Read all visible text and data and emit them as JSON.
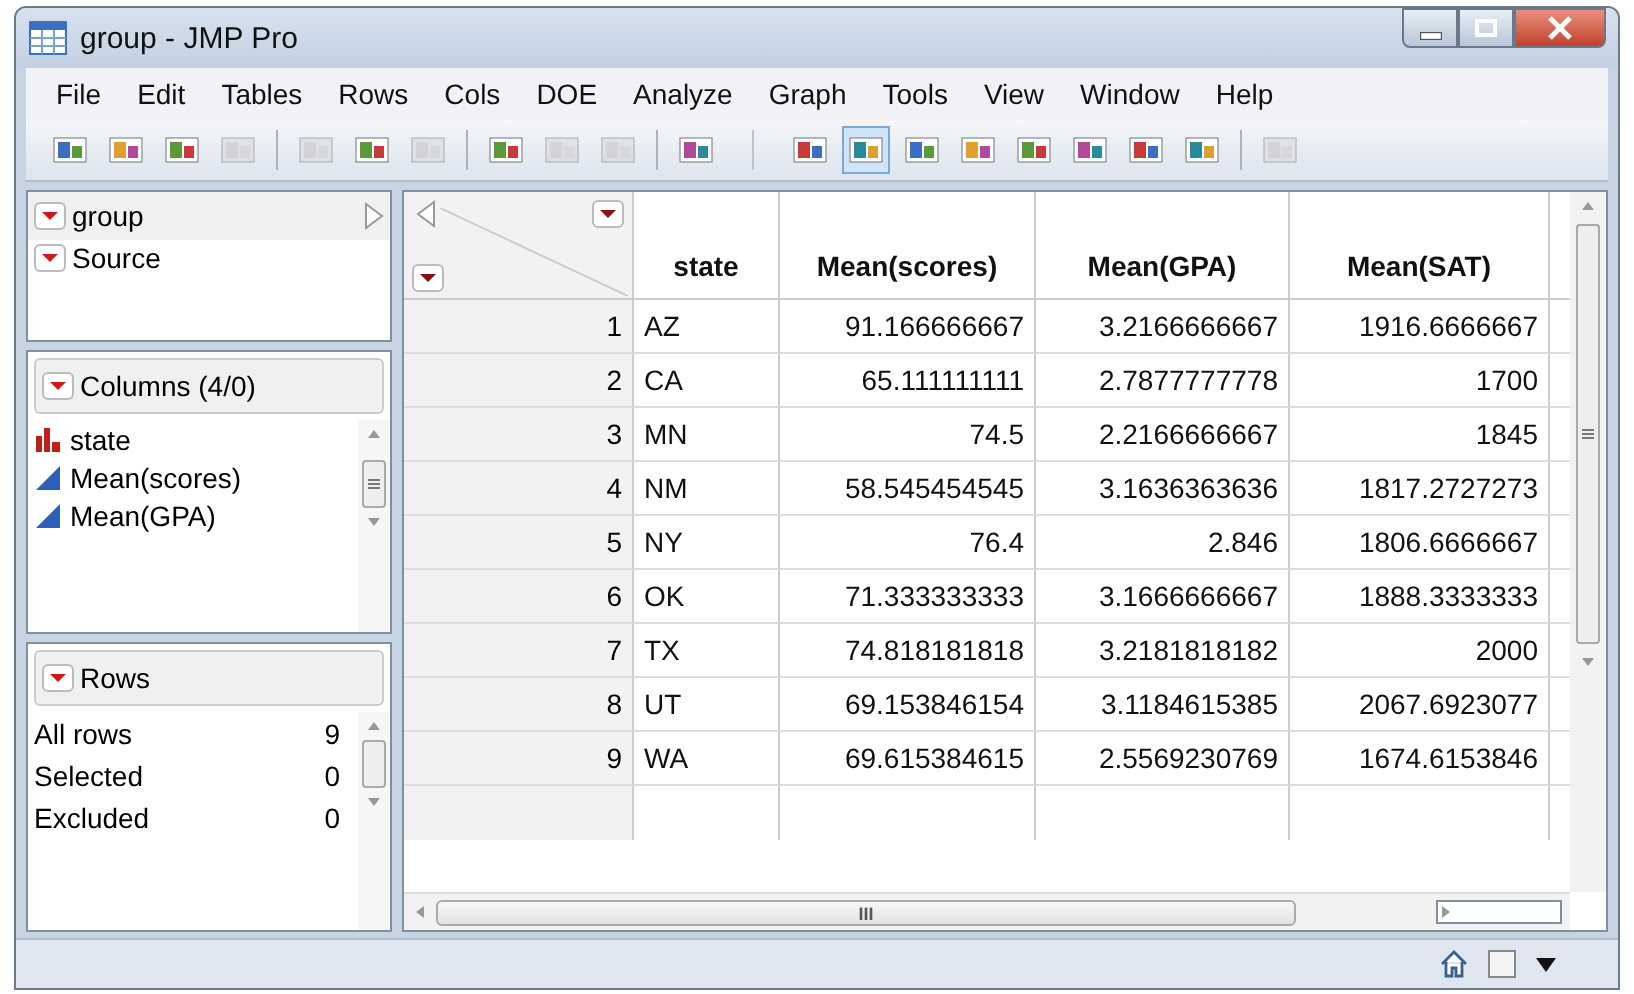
{
  "window": {
    "title": "group - JMP Pro"
  },
  "menu": [
    "File",
    "Edit",
    "Tables",
    "Rows",
    "Cols",
    "DOE",
    "Analyze",
    "Graph",
    "Tools",
    "View",
    "Window",
    "Help"
  ],
  "toolbar": [
    [
      {
        "disabled": false,
        "selected": false
      },
      {
        "disabled": false,
        "selected": false
      },
      {
        "disabled": false,
        "selected": false
      },
      {
        "disabled": true,
        "selected": false
      }
    ],
    [
      {
        "disabled": true,
        "selected": false
      },
      {
        "disabled": false,
        "selected": false
      },
      {
        "disabled": true,
        "selected": false
      }
    ],
    [
      {
        "disabled": false,
        "selected": false
      },
      {
        "disabled": true,
        "selected": false
      },
      {
        "disabled": true,
        "selected": false
      }
    ],
    [
      {
        "disabled": false,
        "selected": false
      }
    ],
    [
      {
        "disabled": false,
        "selected": false
      },
      {
        "disabled": false,
        "selected": true
      },
      {
        "disabled": false,
        "selected": false
      },
      {
        "disabled": false,
        "selected": false
      },
      {
        "disabled": false,
        "selected": false
      },
      {
        "disabled": false,
        "selected": false
      },
      {
        "disabled": false,
        "selected": false
      },
      {
        "disabled": false,
        "selected": false
      }
    ],
    [
      {
        "disabled": true,
        "selected": false
      }
    ]
  ],
  "table_panel": {
    "name": "group",
    "items": [
      "Source"
    ]
  },
  "columns_panel": {
    "title": "Columns (4/0)",
    "items": [
      {
        "name": "state",
        "kind": "nominal"
      },
      {
        "name": "Mean(scores)",
        "kind": "continuous"
      },
      {
        "name": "Mean(GPA)",
        "kind": "continuous"
      }
    ]
  },
  "rows_panel": {
    "title": "Rows",
    "items": [
      {
        "label": "All rows",
        "count": "9"
      },
      {
        "label": "Selected",
        "count": "0"
      },
      {
        "label": "Excluded",
        "count": "0"
      }
    ]
  },
  "table": {
    "columns": [
      "state",
      "Mean(scores)",
      "Mean(GPA)",
      "Mean(SAT)"
    ],
    "rows": [
      {
        "n": "1",
        "cells": [
          "AZ",
          "91.166666667",
          "3.2166666667",
          "1916.6666667"
        ]
      },
      {
        "n": "2",
        "cells": [
          "CA",
          "65.111111111",
          "2.7877777778",
          "1700"
        ]
      },
      {
        "n": "3",
        "cells": [
          "MN",
          "74.5",
          "2.2166666667",
          "1845"
        ]
      },
      {
        "n": "4",
        "cells": [
          "NM",
          "58.545454545",
          "3.1636363636",
          "1817.2727273"
        ]
      },
      {
        "n": "5",
        "cells": [
          "NY",
          "76.4",
          "2.846",
          "1806.6666667"
        ]
      },
      {
        "n": "6",
        "cells": [
          "OK",
          "71.333333333",
          "3.1666666667",
          "1888.3333333"
        ]
      },
      {
        "n": "7",
        "cells": [
          "TX",
          "74.818181818",
          "3.2181818182",
          "2000"
        ]
      },
      {
        "n": "8",
        "cells": [
          "UT",
          "69.153846154",
          "3.1184615385",
          "2067.6923077"
        ]
      },
      {
        "n": "9",
        "cells": [
          "WA",
          "69.615384615",
          "2.5569230769",
          "1674.6153846"
        ]
      }
    ]
  },
  "horizontal_scroll_label": "III"
}
